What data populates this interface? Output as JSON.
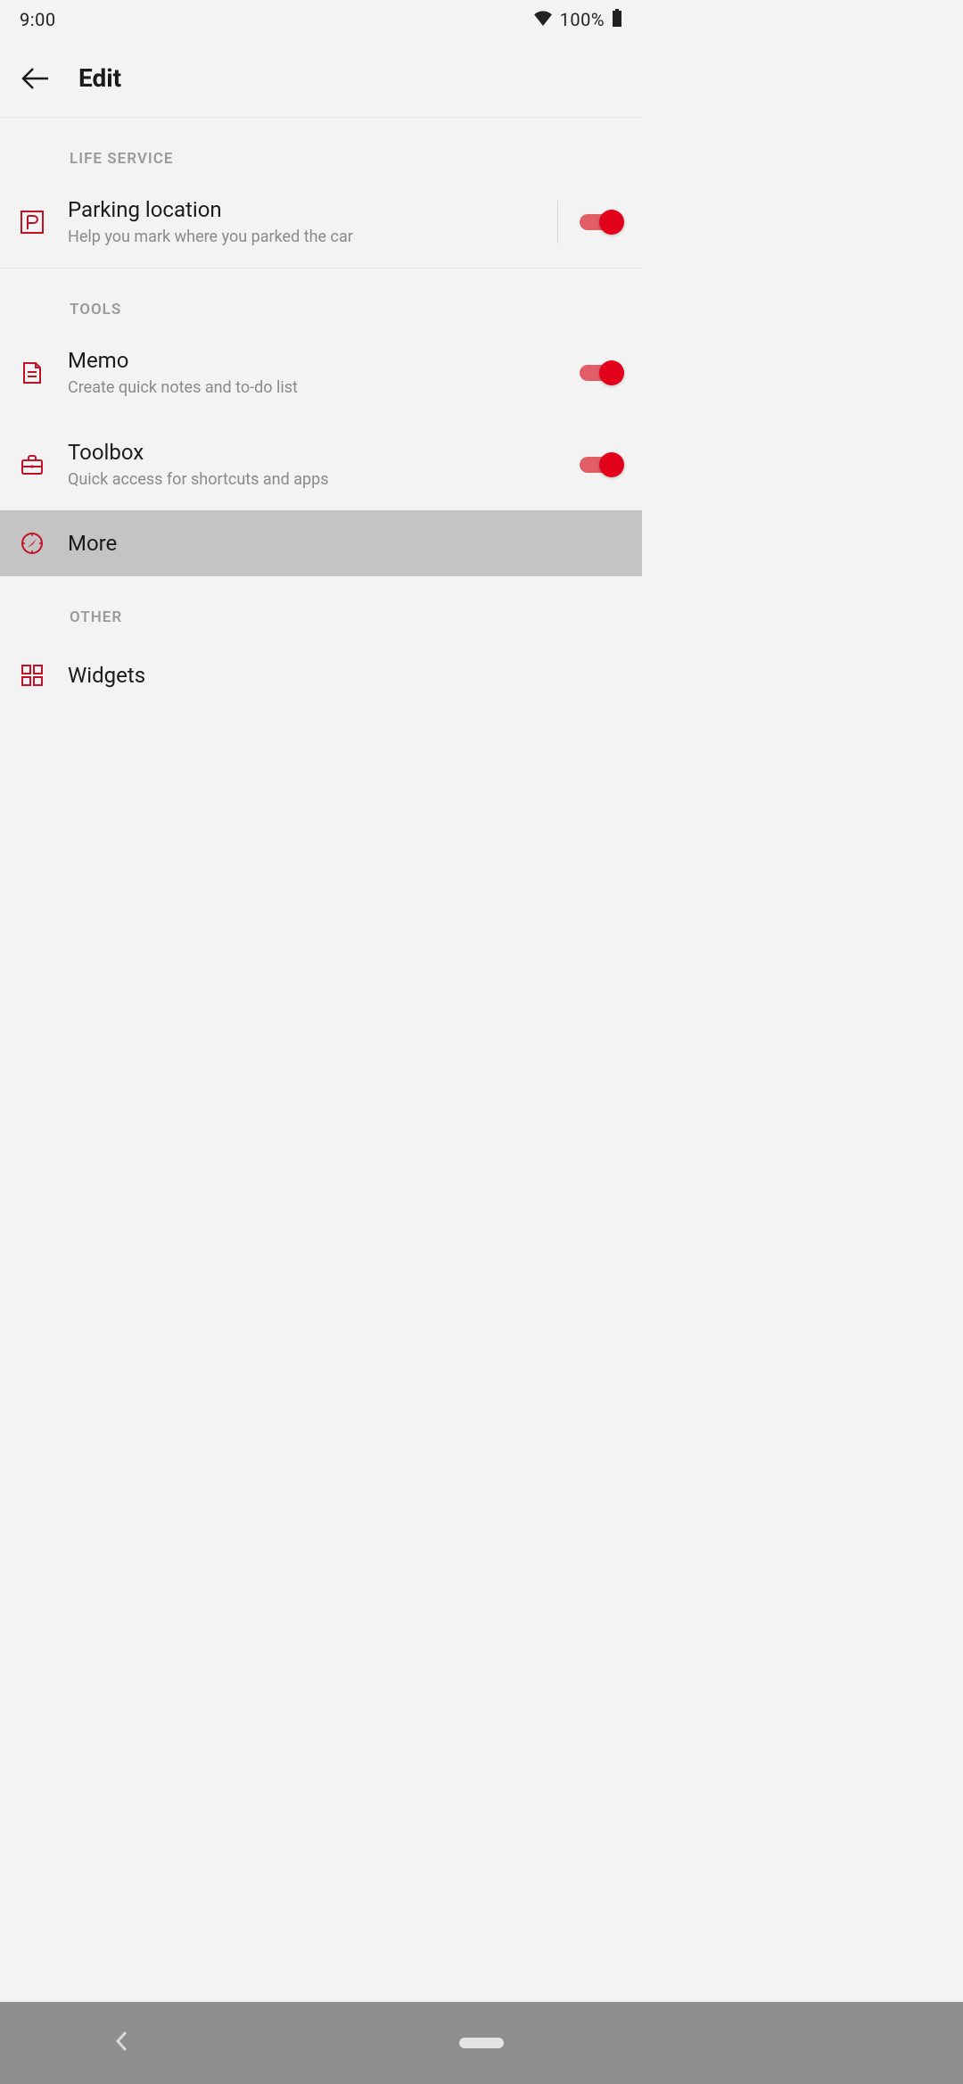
{
  "status": {
    "time": "9:00",
    "battery": "100%"
  },
  "header": {
    "title": "Edit"
  },
  "sections": {
    "life": {
      "label": "LIFE SERVICE",
      "parking": {
        "title": "Parking location",
        "sub": "Help you mark where you parked the car"
      }
    },
    "tools": {
      "label": "TOOLS",
      "memo": {
        "title": "Memo",
        "sub": "Create quick notes and to-do list"
      },
      "toolbox": {
        "title": "Toolbox",
        "sub": "Quick access for shortcuts and apps"
      },
      "more": {
        "title": "More"
      }
    },
    "other": {
      "label": "OTHER",
      "widgets": {
        "title": "Widgets"
      }
    }
  }
}
